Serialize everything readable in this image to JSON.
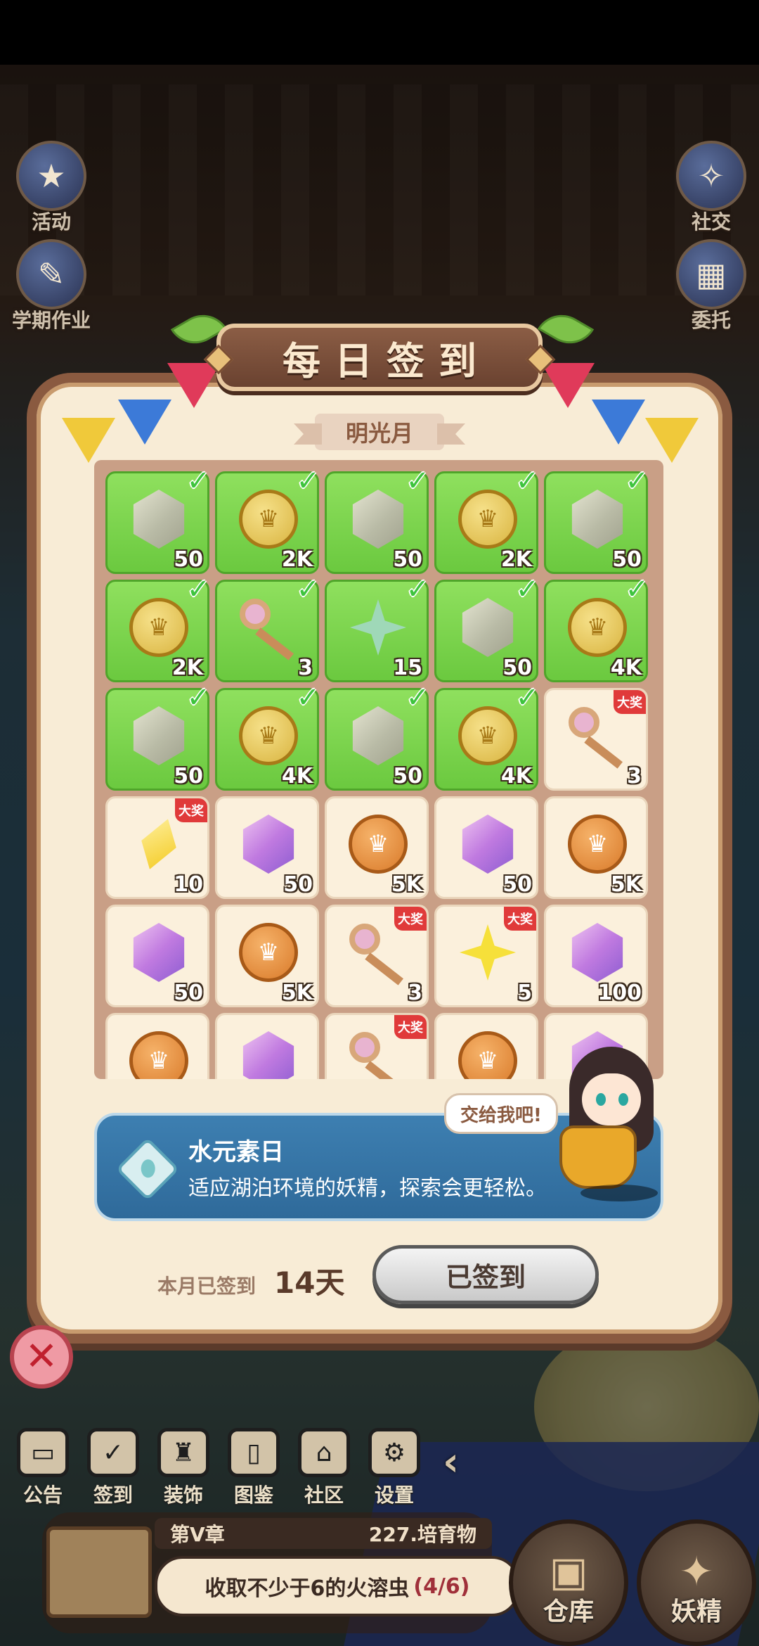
{
  "side_left": [
    {
      "label": "活动",
      "icon": "event-icon"
    },
    {
      "label": "学期作业",
      "icon": "homework-icon"
    }
  ],
  "side_right": [
    {
      "label": "社交",
      "icon": "social-icon"
    },
    {
      "label": "委托",
      "icon": "commission-icon"
    }
  ],
  "dialog": {
    "title": "每日签到",
    "month": "明光月",
    "grand_prize_badge": "大奖",
    "rewards": [
      {
        "qty": "50",
        "type": "gem-gray",
        "claimed": true,
        "grand": false
      },
      {
        "qty": "2K",
        "type": "coin-gold",
        "claimed": true,
        "grand": false
      },
      {
        "qty": "50",
        "type": "gem-gray",
        "claimed": true,
        "grand": false
      },
      {
        "qty": "2K",
        "type": "coin-gold",
        "claimed": true,
        "grand": false
      },
      {
        "qty": "50",
        "type": "gem-gray",
        "claimed": true,
        "grand": false
      },
      {
        "qty": "2K",
        "type": "coin-gold",
        "claimed": true,
        "grand": false
      },
      {
        "qty": "3",
        "type": "key",
        "claimed": true,
        "grand": false
      },
      {
        "qty": "15",
        "type": "star-green",
        "claimed": true,
        "grand": false
      },
      {
        "qty": "50",
        "type": "gem-gray",
        "claimed": true,
        "grand": false
      },
      {
        "qty": "4K",
        "type": "coin-gold",
        "claimed": true,
        "grand": false
      },
      {
        "qty": "50",
        "type": "gem-gray",
        "claimed": true,
        "grand": false
      },
      {
        "qty": "4K",
        "type": "coin-gold",
        "claimed": true,
        "grand": false
      },
      {
        "qty": "50",
        "type": "gem-gray",
        "claimed": true,
        "grand": false
      },
      {
        "qty": "4K",
        "type": "coin-gold",
        "claimed": true,
        "grand": false
      },
      {
        "qty": "3",
        "type": "key",
        "claimed": false,
        "grand": true
      },
      {
        "qty": "10",
        "type": "diamond-yellow",
        "claimed": false,
        "grand": true
      },
      {
        "qty": "50",
        "type": "gem-purple",
        "claimed": false,
        "grand": false
      },
      {
        "qty": "5K",
        "type": "coin-copper",
        "claimed": false,
        "grand": false
      },
      {
        "qty": "50",
        "type": "gem-purple",
        "claimed": false,
        "grand": false
      },
      {
        "qty": "5K",
        "type": "coin-copper",
        "claimed": false,
        "grand": false
      },
      {
        "qty": "50",
        "type": "gem-purple",
        "claimed": false,
        "grand": false
      },
      {
        "qty": "5K",
        "type": "coin-copper",
        "claimed": false,
        "grand": false
      },
      {
        "qty": "3",
        "type": "key",
        "claimed": false,
        "grand": true
      },
      {
        "qty": "5",
        "type": "star-yellow",
        "claimed": false,
        "grand": true
      },
      {
        "qty": "100",
        "type": "gem-purple",
        "claimed": false,
        "grand": false
      },
      {
        "qty": "",
        "type": "coin-copper",
        "claimed": false,
        "grand": false
      },
      {
        "qty": "",
        "type": "gem-purple",
        "claimed": false,
        "grand": false
      },
      {
        "qty": "",
        "type": "key",
        "claimed": false,
        "grand": true
      },
      {
        "qty": "",
        "type": "coin-copper",
        "claimed": false,
        "grand": false
      },
      {
        "qty": "",
        "type": "gem-purple",
        "claimed": false,
        "grand": false
      }
    ],
    "info_title": "水元素日",
    "info_desc": "适应湖泊环境的妖精，探索会更轻松。",
    "speech": "交给我吧!",
    "signed_label": "本月已签到",
    "signed_days": "14天",
    "signed_button": "已签到",
    "close_symbol": "✕"
  },
  "bottom_nav": [
    {
      "label": "公告",
      "icon": "notice-icon",
      "glyph": "▭"
    },
    {
      "label": "签到",
      "icon": "checkin-icon",
      "glyph": "✓"
    },
    {
      "label": "装饰",
      "icon": "decor-icon",
      "glyph": "♜"
    },
    {
      "label": "图鉴",
      "icon": "codex-icon",
      "glyph": "▯"
    },
    {
      "label": "社区",
      "icon": "community-icon",
      "glyph": "⌂"
    },
    {
      "label": "设置",
      "icon": "settings-icon",
      "glyph": "⚙"
    }
  ],
  "quest": {
    "chapter": "第V章",
    "resource": "227.培育物",
    "task": "收取不少于6的火溶虫",
    "progress": "(4/6)"
  },
  "big_buttons": [
    {
      "label": "仓库",
      "icon": "warehouse-icon",
      "glyph": "▣"
    },
    {
      "label": "妖精",
      "icon": "fairy-icon",
      "glyph": "✦"
    }
  ]
}
